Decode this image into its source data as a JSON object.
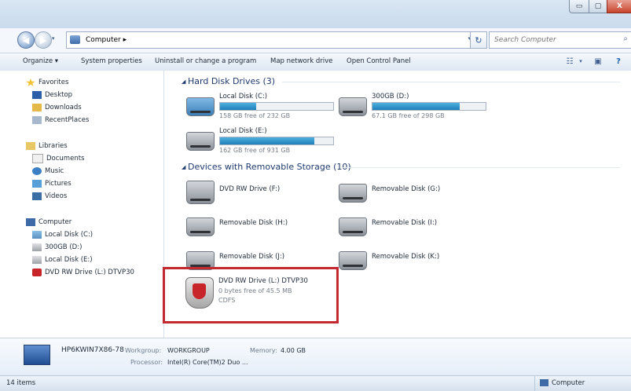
{
  "window": {
    "min_label": "▭",
    "max_label": "▢",
    "close_label": "X"
  },
  "address": {
    "crumb": "Computer ▸",
    "search_placeholder": "Search Computer"
  },
  "toolbar": {
    "items": [
      "Organize ▾",
      "System properties",
      "Uninstall or change a program",
      "Map network drive",
      "Open Control Panel"
    ]
  },
  "nav": {
    "favorites": "Favorites",
    "desktop": "Desktop",
    "downloads": "Downloads",
    "recent": "RecentPlaces",
    "libraries": "Libraries",
    "documents": "Documents",
    "music": "Music",
    "pictures": "Pictures",
    "videos": "Videos",
    "computer": "Computer",
    "localc": "Local Disk (C:)",
    "d300": "300GB (D:)",
    "locale": "Local Disk (E:)",
    "dvd": "DVD RW Drive (L:) DTVP30"
  },
  "groups": {
    "hdd": "Hard Disk Drives (3)",
    "removable": "Devices with Removable Storage (10)"
  },
  "drives": {
    "c": {
      "name": "Local Disk (C:)",
      "free": "158 GB free of 232 GB",
      "used_fraction": 0.32
    },
    "d": {
      "name": "300GB (D:)",
      "free": "67.1 GB free of 298 GB",
      "used_fraction": 0.77
    },
    "e": {
      "name": "Local Disk (E:)",
      "free": "162 GB free of 931 GB",
      "used_fraction": 0.83
    }
  },
  "removable": {
    "f": "DVD RW Drive (F:)",
    "g": "Removable Disk (G:)",
    "h": "Removable Disk (H:)",
    "i": "Removable Disk (I:)",
    "j": "Removable Disk (J:)",
    "k": "Removable Disk (K:)"
  },
  "selected": {
    "name": "DVD RW Drive (L:) DTVP30",
    "free": "0 bytes free of 45.5 MB",
    "fs": "CDFS"
  },
  "details": {
    "pcname": "HP6KWIN7X86-78",
    "workgroup_label": "Workgroup:",
    "workgroup": "WORKGROUP",
    "memory_label": "Memory:",
    "memory": "4.00 GB",
    "processor_label": "Processor:",
    "processor": "Intel(R) Core(TM)2 Duo ..."
  },
  "status": {
    "items": "14 items",
    "location": "Computer"
  }
}
